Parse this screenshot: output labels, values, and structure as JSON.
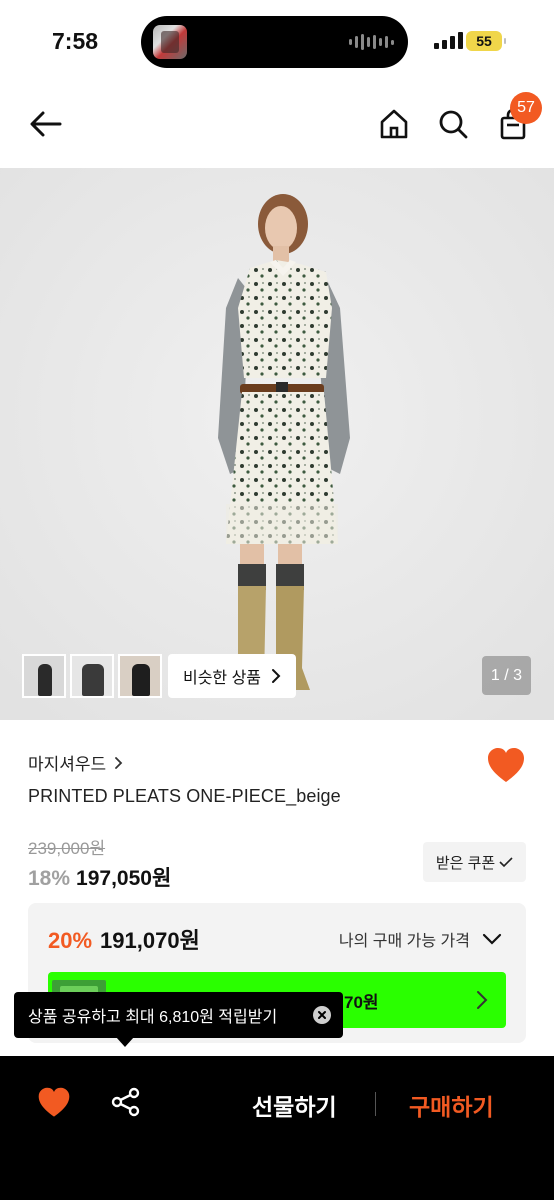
{
  "status_bar": {
    "time": "7:58",
    "battery": "55"
  },
  "top_nav": {
    "cart_count": "57",
    "icons": [
      "back-arrow-icon",
      "home-icon",
      "search-icon",
      "shopping-bag-icon"
    ]
  },
  "gallery": {
    "page_indicator": "1 / 3",
    "similar_label": "비슷한 상품",
    "thumbnail_count": 3
  },
  "product": {
    "brand": "마지셔우드",
    "name": "PRINTED PLEATS ONE-PIECE_beige",
    "original_price": "239,000원",
    "discount": "18%",
    "sale_price": "197,050원",
    "coupon_label": "받은 쿠폰"
  },
  "my_price": {
    "discount": "20%",
    "price": "191,070원",
    "label": "나의 구매 가능 가격",
    "banner_text": "70원"
  },
  "tooltip": {
    "text": "상품 공유하고 최대 6,810원 적립받기"
  },
  "bottom_bar": {
    "gift_label": "선물하기",
    "buy_label": "구매하기"
  },
  "colors": {
    "accent": "#f25a22",
    "green_banner": "#2aff00",
    "battery": "#f0d64a"
  }
}
